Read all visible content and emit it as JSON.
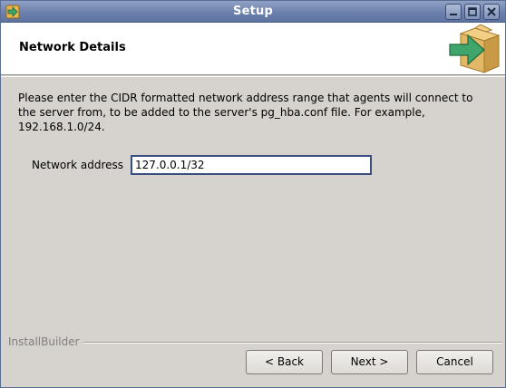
{
  "window": {
    "title": "Setup",
    "icons": {
      "app": "installer-arrow-icon",
      "minimize": "minimize-icon",
      "maximize": "maximize-icon",
      "close": "close-icon"
    }
  },
  "header": {
    "heading": "Network Details",
    "icon": "package-arrow-icon"
  },
  "content": {
    "description": "Please enter the CIDR formatted network address range that agents will connect to the server from, to be added to the server's pg_hba.conf file. For example, 192.168.1.0/24.",
    "network_address_label": "Network address",
    "network_address_value": "127.0.0.1/32"
  },
  "footer": {
    "brand": "InstallBuilder",
    "back_label": "< Back",
    "next_label": "Next >",
    "cancel_label": "Cancel"
  },
  "colors": {
    "titlebar": "#6c81ad",
    "window_bg": "#d6d2cd",
    "arrow_green": "#3fa56a",
    "box_tan": "#e2b765"
  }
}
